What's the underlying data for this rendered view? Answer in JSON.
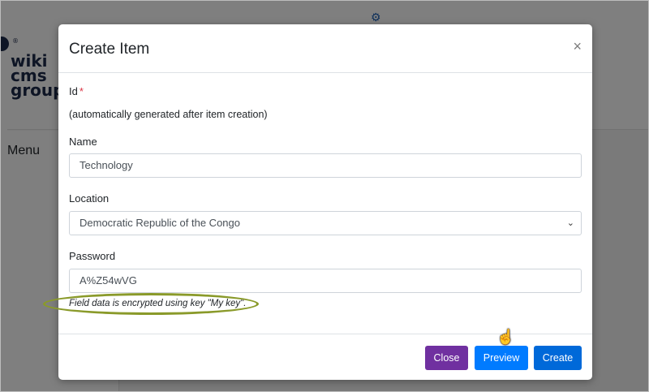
{
  "background": {
    "logo": {
      "line1": "wiki",
      "line2": "cms",
      "line3": "group",
      "registered": "®"
    },
    "menu_label": "Menu",
    "gear_icon": "gear-icon"
  },
  "modal": {
    "title": "Create Item",
    "close_glyph": "×",
    "fields": {
      "id": {
        "label": "Id",
        "required_mark": "*",
        "hint": "(automatically generated after item creation)"
      },
      "name": {
        "label": "Name",
        "value": "Technology"
      },
      "location": {
        "label": "Location",
        "value": "Democratic Republic of the Congo",
        "chevron": "chevron-down-icon"
      },
      "password": {
        "label": "Password",
        "value": "A%Z54wVG",
        "note": "Field data is encrypted using key \"My key\"."
      }
    },
    "buttons": {
      "close": "Close",
      "preview": "Preview",
      "create": "Create"
    }
  },
  "colors": {
    "close_button": "#7030a0",
    "primary_button": "#007bff",
    "annotation_ellipse": "#8a9a2a",
    "required": "#dc3545"
  }
}
